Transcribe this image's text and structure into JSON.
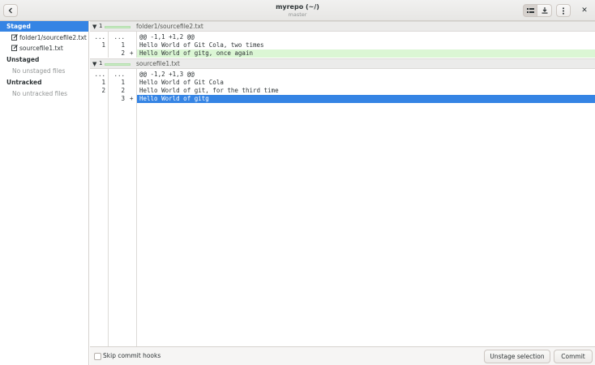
{
  "header": {
    "title": "myrepo (~/)",
    "subtitle": "master",
    "back_icon": "chevron-left-icon",
    "view_icon": "list-view-icon",
    "download_icon": "download-icon",
    "menu_icon": "kebab-menu-icon",
    "close_label": "✕"
  },
  "sidebar": {
    "staged": {
      "label": "Staged",
      "files": [
        {
          "name": "folder1/sourcefile2.txt",
          "icon": "edit-file-icon"
        },
        {
          "name": "sourcefile1.txt",
          "icon": "edit-file-icon"
        }
      ]
    },
    "unstaged": {
      "label": "Unstaged",
      "empty": "No unstaged files"
    },
    "untracked": {
      "label": "Untracked",
      "empty": "No untracked files"
    }
  },
  "diff": {
    "files": [
      {
        "count": "1",
        "name": "folder1/sourcefile2.txt",
        "lines": [
          {
            "old": "...",
            "new": "...",
            "sym": "",
            "text": "@@ -1,1 +1,2 @@",
            "kind": "hunk"
          },
          {
            "old": "1",
            "new": "1",
            "sym": "",
            "text": "Hello World of Git Cola, two times",
            "kind": "context"
          },
          {
            "old": "",
            "new": "2",
            "sym": "+",
            "text": "Hello World of gitg, once again",
            "kind": "added"
          }
        ]
      },
      {
        "count": "1",
        "name": "sourcefile1.txt",
        "lines": [
          {
            "old": "...",
            "new": "...",
            "sym": "",
            "text": "@@ -1,2 +1,3 @@",
            "kind": "hunk"
          },
          {
            "old": "1",
            "new": "1",
            "sym": "",
            "text": "Hello World of Git Cola",
            "kind": "context"
          },
          {
            "old": "2",
            "new": "2",
            "sym": "",
            "text": "Hello World of git, for the third time",
            "kind": "context"
          },
          {
            "old": "",
            "new": "3",
            "sym": "+",
            "text": "Hello World of gitg",
            "kind": "selected"
          }
        ]
      }
    ]
  },
  "actions": {
    "skip_hooks_label": "Skip commit hooks",
    "skip_hooks_checked": false,
    "unstage_label": "Unstage selection",
    "commit_label": "Commit"
  },
  "colors": {
    "accent": "#3584e4",
    "added_bg": "#dbf6d4",
    "header_bg": "#ebebea"
  }
}
